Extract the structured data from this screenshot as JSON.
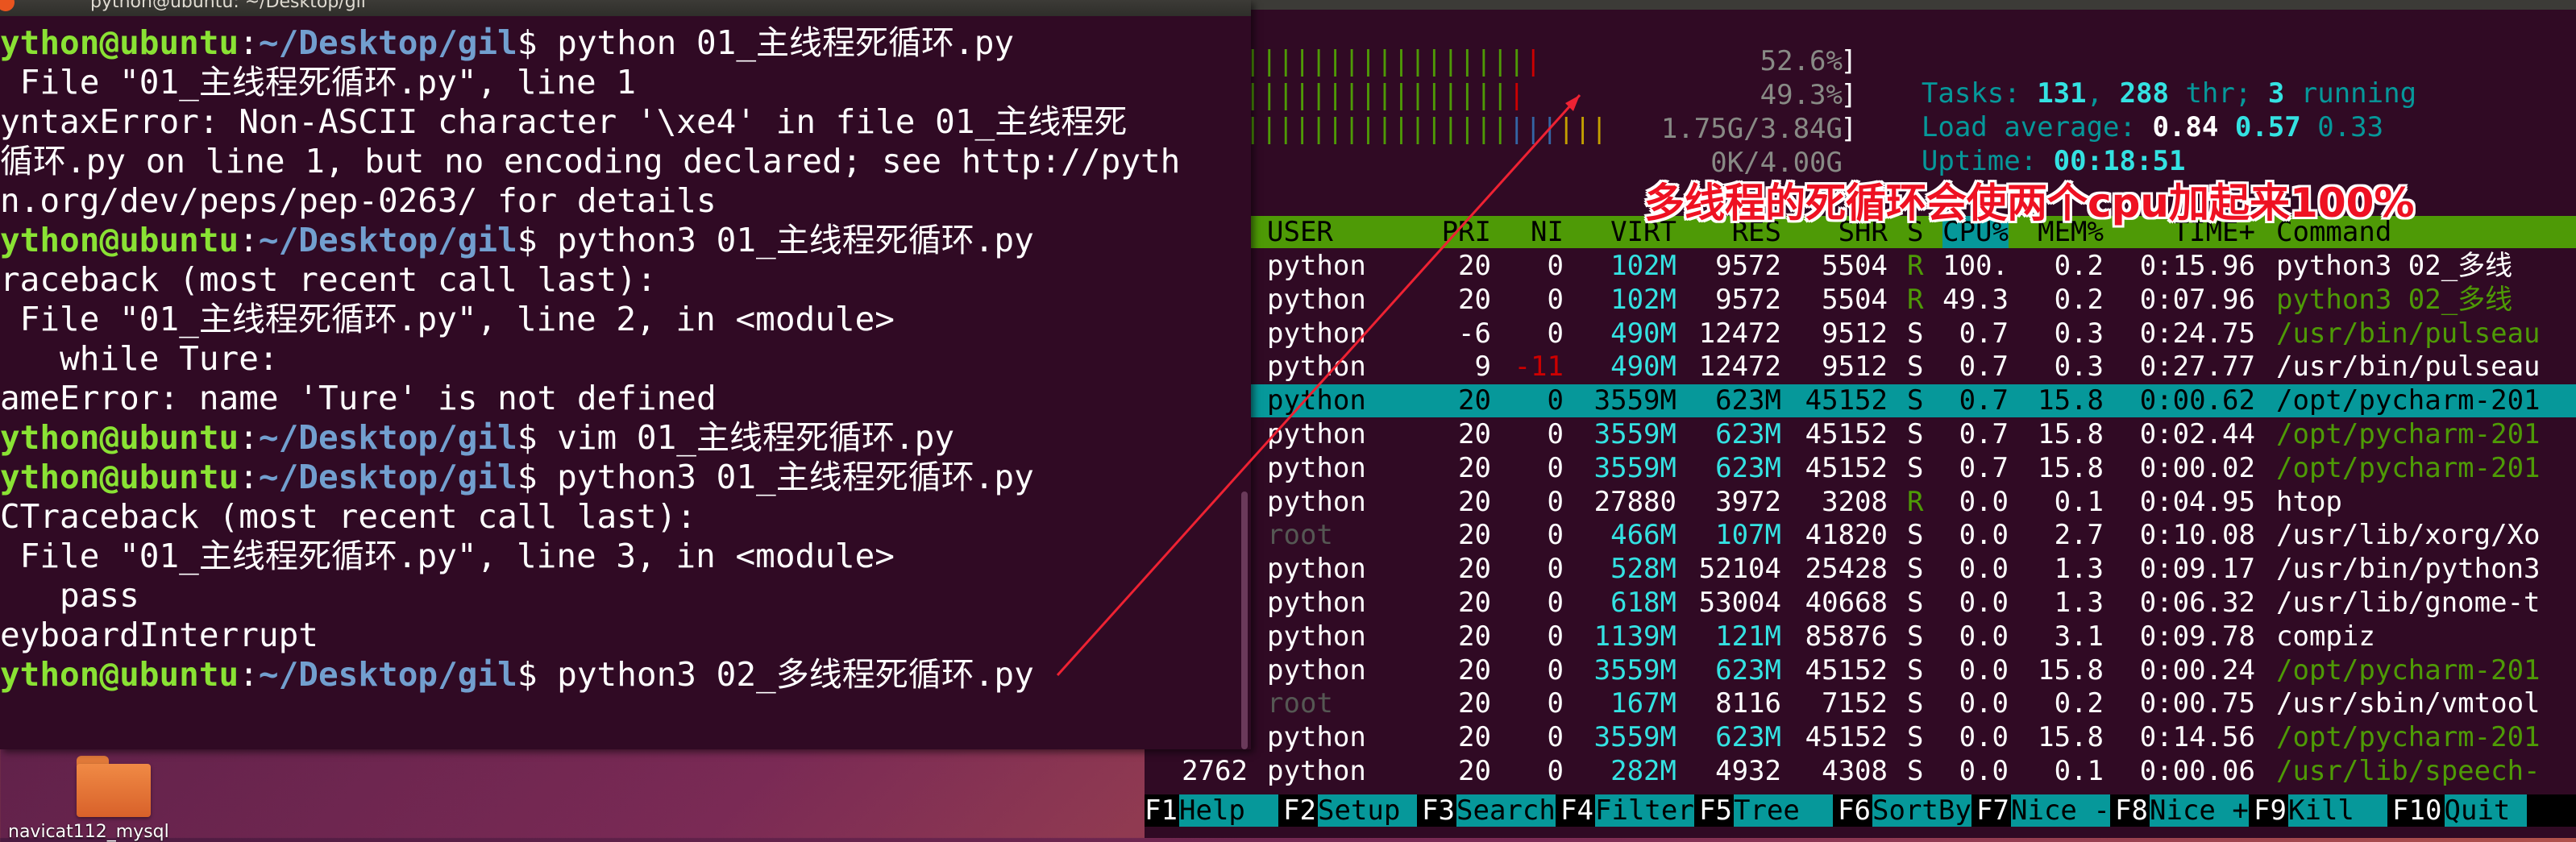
{
  "colors": {
    "terminal_bg": "#300a24",
    "prompt_user": "#8ae234",
    "prompt_path": "#729fcf",
    "htop_header_green": "#4e9a06",
    "htop_selected_cyan": "#06989a",
    "annotation_red": "#ee1122"
  },
  "desktop": {
    "icon_name": "folder-icon",
    "icon_label": "navicat112_mysql"
  },
  "terminal": {
    "title": "python@ubuntu: ~/Desktop/gil",
    "lines": [
      {
        "user": "ython@ubuntu",
        "sep": ":",
        "path": "~/Desktop/gil",
        "rest": "$ python 01_主线程死循环.py"
      },
      {
        "text": " File \"01_主线程死循环.py\", line 1"
      },
      {
        "text": "yntaxError: Non-ASCII character '\\xe4' in file 01_主线程死"
      },
      {
        "text": "循环.py on line 1, but no encoding declared; see http://pyth"
      },
      {
        "text": "n.org/dev/peps/pep-0263/ for details"
      },
      {
        "user": "ython@ubuntu",
        "sep": ":",
        "path": "~/Desktop/gil",
        "rest": "$ python3 01_主线程死循环.py"
      },
      {
        "text": "raceback (most recent call last):"
      },
      {
        "text": " File \"01_主线程死循环.py\", line 2, in <module>"
      },
      {
        "text": "   while Ture:"
      },
      {
        "text": "ameError: name 'Ture' is not defined"
      },
      {
        "user": "ython@ubuntu",
        "sep": ":",
        "path": "~/Desktop/gil",
        "rest": "$ vim 01_主线程死循环.py"
      },
      {
        "user": "ython@ubuntu",
        "sep": ":",
        "path": "~/Desktop/gil",
        "rest": "$ python3 01_主线程死循环.py"
      },
      {
        "text": "CTraceback (most recent call last):"
      },
      {
        "text": " File \"01_主线程死循环.py\", line 3, in <module>"
      },
      {
        "text": "   pass"
      },
      {
        "text": "eyboardInterrupt"
      },
      {
        "user": "ython@ubuntu",
        "sep": ":",
        "path": "~/Desktop/gil",
        "rest": "$ python3 02_多线程死循环.py"
      }
    ]
  },
  "htop": {
    "meters": [
      {
        "bars_green": "|||||||||||||||||",
        "bars_red": "|",
        "value": "52.6%"
      },
      {
        "bars_green": "||||||||||||||||",
        "bars_red": "|",
        "value": "49.3%"
      },
      {
        "bars_green": "||||||||||||||||",
        "bars_blue": "|||",
        "bars_yellow": "|||",
        "value": "1.75G/3.84G"
      },
      {
        "value": "0K/4.00G"
      }
    ],
    "tasks": {
      "label": "Tasks: ",
      "tasks": "131",
      "sep1": ", ",
      "thr": "288",
      "thr_label": " thr; ",
      "running": "3",
      "running_label": " running"
    },
    "load": {
      "label": "Load average: ",
      "v1": "0.84",
      "v2": "0.57",
      "v3": "0.33"
    },
    "uptime": {
      "label": "Uptime: ",
      "value": "00:18:51"
    },
    "columns": [
      "USER",
      "PRI",
      "NI",
      "VIRT",
      "RES",
      "SHR",
      "S",
      "CPU%",
      "MEM%",
      "TIME+",
      "Command"
    ],
    "processes": [
      {
        "pid": "",
        "user": "python",
        "pri": "20",
        "ni": "0",
        "virt": "102M",
        "res": "9572",
        "shr": "5504",
        "s": "R",
        "cpu": "100.",
        "mem": "0.2",
        "time": "0:15.96",
        "cmd": "python3 02_多线",
        "cmd_color": "white"
      },
      {
        "pid": "",
        "user": "python",
        "pri": "20",
        "ni": "0",
        "virt": "102M",
        "res": "9572",
        "shr": "5504",
        "s": "R",
        "cpu": "49.3",
        "mem": "0.2",
        "time": "0:07.96",
        "cmd": "python3 02_多线",
        "cmd_color": "green"
      },
      {
        "pid": "",
        "user": "python",
        "pri": "-6",
        "ni": "0",
        "virt": "490M",
        "res": "12472",
        "shr": "9512",
        "s": "S",
        "cpu": "0.7",
        "mem": "0.3",
        "time": "0:24.75",
        "cmd": "/usr/bin/pulseau",
        "cmd_color": "green"
      },
      {
        "pid": "",
        "user": "python",
        "pri": "9",
        "ni": "-11",
        "virt": "490M",
        "res": "12472",
        "shr": "9512",
        "s": "S",
        "cpu": "0.7",
        "mem": "0.3",
        "time": "0:27.77",
        "cmd": "/usr/bin/pulseau",
        "cmd_color": "white"
      },
      {
        "pid": "",
        "user": "python",
        "pri": "20",
        "ni": "0",
        "virt": "3559M",
        "res": "623M",
        "shr": "45152",
        "s": "S",
        "cpu": "0.7",
        "mem": "15.8",
        "time": "0:00.62",
        "cmd": "/opt/pycharm-201",
        "cmd_color": "white",
        "selected": true
      },
      {
        "pid": "",
        "user": "python",
        "pri": "20",
        "ni": "0",
        "virt": "3559M",
        "res": "623M",
        "shr": "45152",
        "s": "S",
        "cpu": "0.7",
        "mem": "15.8",
        "time": "0:02.44",
        "cmd": "/opt/pycharm-201",
        "cmd_color": "green"
      },
      {
        "pid": "",
        "user": "python",
        "pri": "20",
        "ni": "0",
        "virt": "3559M",
        "res": "623M",
        "shr": "45152",
        "s": "S",
        "cpu": "0.7",
        "mem": "15.8",
        "time": "0:00.02",
        "cmd": "/opt/pycharm-201",
        "cmd_color": "green"
      },
      {
        "pid": "",
        "user": "python",
        "pri": "20",
        "ni": "0",
        "virt": "27880",
        "res": "3972",
        "shr": "3208",
        "s": "R",
        "cpu": "0.0",
        "mem": "0.1",
        "time": "0:04.95",
        "cmd": "htop",
        "cmd_color": "white"
      },
      {
        "pid": "",
        "user": "root",
        "pri": "20",
        "ni": "0",
        "virt": "466M",
        "res": "107M",
        "shr": "41820",
        "s": "S",
        "cpu": "0.0",
        "mem": "2.7",
        "time": "0:10.08",
        "cmd": "/usr/lib/xorg/Xo",
        "cmd_color": "white",
        "dim_user": true
      },
      {
        "pid": "",
        "user": "python",
        "pri": "20",
        "ni": "0",
        "virt": "528M",
        "res": "52104",
        "shr": "25428",
        "s": "S",
        "cpu": "0.0",
        "mem": "1.3",
        "time": "0:09.17",
        "cmd": "/usr/bin/python3",
        "cmd_color": "white"
      },
      {
        "pid": "",
        "user": "python",
        "pri": "20",
        "ni": "0",
        "virt": "618M",
        "res": "53004",
        "shr": "40668",
        "s": "S",
        "cpu": "0.0",
        "mem": "1.3",
        "time": "0:06.32",
        "cmd": "/usr/lib/gnome-t",
        "cmd_color": "white"
      },
      {
        "pid": "",
        "user": "python",
        "pri": "20",
        "ni": "0",
        "virt": "1139M",
        "res": "121M",
        "shr": "85876",
        "s": "S",
        "cpu": "0.0",
        "mem": "3.1",
        "time": "0:09.78",
        "cmd": "compiz",
        "cmd_color": "white"
      },
      {
        "pid": "",
        "user": "python",
        "pri": "20",
        "ni": "0",
        "virt": "3559M",
        "res": "623M",
        "shr": "45152",
        "s": "S",
        "cpu": "0.0",
        "mem": "15.8",
        "time": "0:00.24",
        "cmd": "/opt/pycharm-201",
        "cmd_color": "green"
      },
      {
        "pid": "",
        "user": "root",
        "pri": "20",
        "ni": "0",
        "virt": "167M",
        "res": "8116",
        "shr": "7152",
        "s": "S",
        "cpu": "0.0",
        "mem": "0.2",
        "time": "0:00.75",
        "cmd": "/usr/sbin/vmtool",
        "cmd_color": "white",
        "dim_user": true
      },
      {
        "pid": "",
        "user": "python",
        "pri": "20",
        "ni": "0",
        "virt": "3559M",
        "res": "623M",
        "shr": "45152",
        "s": "S",
        "cpu": "0.0",
        "mem": "15.8",
        "time": "0:14.56",
        "cmd": "/opt/pycharm-201",
        "cmd_color": "green"
      },
      {
        "pid": "2762",
        "user": "python",
        "pri": "20",
        "ni": "0",
        "virt": "282M",
        "res": "4932",
        "shr": "4308",
        "s": "S",
        "cpu": "0.0",
        "mem": "0.1",
        "time": "0:00.06",
        "cmd": "/usr/lib/speech-",
        "cmd_color": "green"
      }
    ],
    "function_keys": [
      {
        "key": "F1",
        "label": "Help  "
      },
      {
        "key": "F2",
        "label": "Setup "
      },
      {
        "key": "F3",
        "label": "Search"
      },
      {
        "key": "F4",
        "label": "Filter"
      },
      {
        "key": "F5",
        "label": "Tree  "
      },
      {
        "key": "F6",
        "label": "SortBy"
      },
      {
        "key": "F7",
        "label": "Nice -"
      },
      {
        "key": "F8",
        "label": "Nice +"
      },
      {
        "key": "F9",
        "label": "Kill  "
      },
      {
        "key": "F10",
        "label": "Quit "
      }
    ]
  },
  "annotation": {
    "text": "多线程的死循环会使两个cpu加起来100%"
  }
}
